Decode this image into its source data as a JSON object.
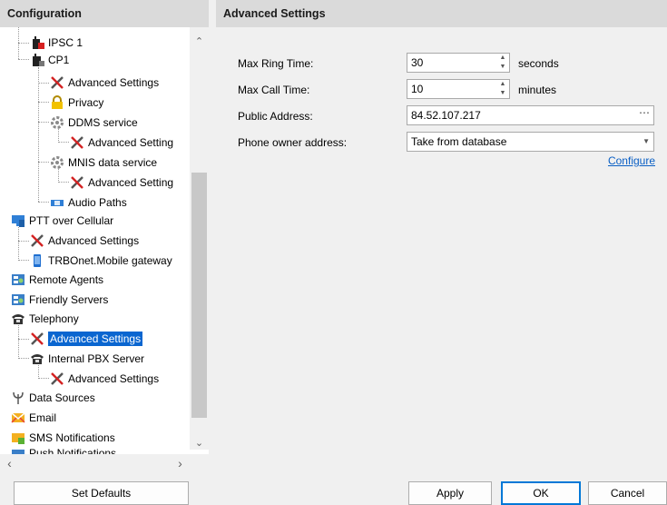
{
  "left_panel": {
    "title": "Configuration"
  },
  "right_panel": {
    "title": "Advanced Settings"
  },
  "tree": [
    {
      "label": "IPSC 1",
      "icon": "radio-locked-icon"
    },
    {
      "label": "CP1",
      "icon": "radio-locked-icon"
    },
    {
      "label": "Advanced Settings",
      "icon": "tools-icon"
    },
    {
      "label": "Privacy",
      "icon": "lock-icon"
    },
    {
      "label": "DDMS service",
      "icon": "gear-icon"
    },
    {
      "label": "Advanced Setting",
      "icon": "tools-icon"
    },
    {
      "label": "MNIS data service",
      "icon": "gear-icon"
    },
    {
      "label": "Advanced Setting",
      "icon": "tools-icon"
    },
    {
      "label": "Audio Paths",
      "icon": "audio-paths-icon"
    },
    {
      "label": "PTT over Cellular",
      "icon": "monitor-icon"
    },
    {
      "label": "Advanced Settings",
      "icon": "tools-icon"
    },
    {
      "label": "TRBOnet.Mobile gateway",
      "icon": "mobile-icon"
    },
    {
      "label": "Remote Agents",
      "icon": "agents-icon"
    },
    {
      "label": "Friendly Servers",
      "icon": "servers-icon"
    },
    {
      "label": "Telephony",
      "icon": "telephone-icon"
    },
    {
      "label": "Advanced Settings",
      "icon": "tools-icon"
    },
    {
      "label": "Internal PBX Server",
      "icon": "telephone-icon"
    },
    {
      "label": "Advanced Settings",
      "icon": "tools-icon"
    },
    {
      "label": "Data Sources",
      "icon": "antenna-icon"
    },
    {
      "label": "Email",
      "icon": "email-icon"
    },
    {
      "label": "SMS Notifications",
      "icon": "sms-icon"
    },
    {
      "label": "Push Notifications",
      "icon": "push-icon"
    }
  ],
  "form": {
    "max_ring_time": {
      "label": "Max Ring Time:",
      "value": "30",
      "unit": "seconds"
    },
    "max_call_time": {
      "label": "Max Call Time:",
      "value": "10",
      "unit": "minutes"
    },
    "public_address": {
      "label": "Public Address:",
      "value": "84.52.107.217"
    },
    "phone_owner": {
      "label": "Phone owner address:",
      "value": "Take from database"
    },
    "configure_link": "Configure"
  },
  "buttons": {
    "set_defaults": "Set Defaults",
    "apply": "Apply",
    "ok": "OK",
    "cancel": "Cancel"
  },
  "colors": {
    "selection": "#0a66d0",
    "link": "#0a5fc4",
    "header_bg": "#dadada"
  }
}
